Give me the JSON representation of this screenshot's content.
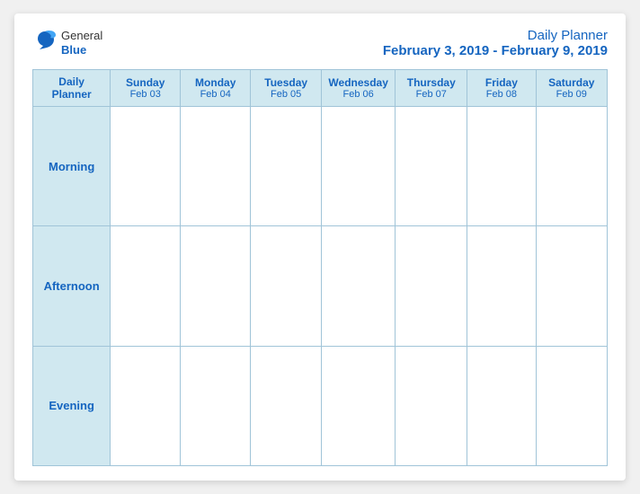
{
  "header": {
    "logo": {
      "general": "General",
      "blue": "Blue",
      "bird_symbol": "🐦"
    },
    "title_line1": "Daily Planner",
    "title_line2": "February 3, 2019 - February 9, 2019"
  },
  "table": {
    "corner_line1": "Daily",
    "corner_line2": "Planner",
    "columns": [
      {
        "day": "Sunday",
        "date": "Feb 03"
      },
      {
        "day": "Monday",
        "date": "Feb 04"
      },
      {
        "day": "Tuesday",
        "date": "Feb 05"
      },
      {
        "day": "Wednesday",
        "date": "Feb 06"
      },
      {
        "day": "Thursday",
        "date": "Feb 07"
      },
      {
        "day": "Friday",
        "date": "Feb 08"
      },
      {
        "day": "Saturday",
        "date": "Feb 09"
      }
    ],
    "rows": [
      {
        "label": "Morning"
      },
      {
        "label": "Afternoon"
      },
      {
        "label": "Evening"
      }
    ]
  }
}
